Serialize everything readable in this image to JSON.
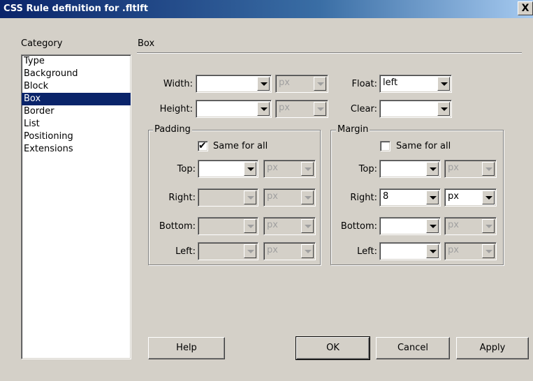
{
  "window": {
    "title": "CSS Rule definition for .fltlft",
    "close_label": "X"
  },
  "category": {
    "label": "Category",
    "items": [
      "Type",
      "Background",
      "Block",
      "Box",
      "Border",
      "List",
      "Positioning",
      "Extensions"
    ],
    "selected": "Box"
  },
  "panel": {
    "title": "Box"
  },
  "box": {
    "width_label": "Width:",
    "width_value": "",
    "width_unit": "px",
    "height_label": "Height:",
    "height_value": "",
    "height_unit": "px",
    "float_label": "Float:",
    "float_value": "left",
    "clear_label": "Clear:",
    "clear_value": ""
  },
  "padding": {
    "legend": "Padding",
    "same_for_all_label": "Same for all",
    "same_for_all_checked": true,
    "top_label": "Top:",
    "top_value": "",
    "top_unit": "px",
    "right_label": "Right:",
    "right_value": "",
    "right_unit": "px",
    "bottom_label": "Bottom:",
    "bottom_value": "",
    "bottom_unit": "px",
    "left_label": "Left:",
    "left_value": "",
    "left_unit": "px"
  },
  "margin": {
    "legend": "Margin",
    "same_for_all_label": "Same for all",
    "same_for_all_checked": false,
    "top_label": "Top:",
    "top_value": "",
    "top_unit": "px",
    "right_label": "Right:",
    "right_value": "8",
    "right_unit": "px",
    "bottom_label": "Bottom:",
    "bottom_value": "",
    "bottom_unit": "px",
    "left_label": "Left:",
    "left_value": "",
    "left_unit": "px"
  },
  "buttons": {
    "help": "Help",
    "ok": "OK",
    "cancel": "Cancel",
    "apply": "Apply"
  },
  "colors": {
    "face": "#d4d0c8",
    "selection": "#0a246a",
    "title_start": "#0a246a",
    "title_end": "#a6caf0"
  }
}
